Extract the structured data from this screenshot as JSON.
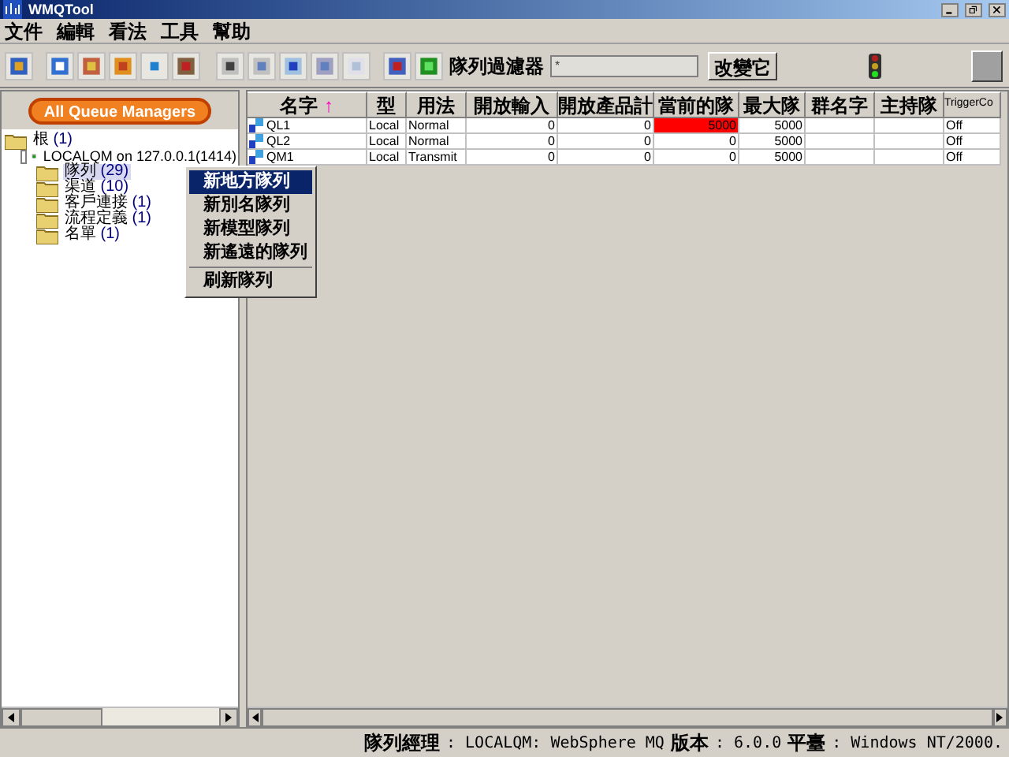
{
  "window": {
    "title": "WMQTool"
  },
  "menu": [
    "文件",
    "編輯",
    "看法",
    "工具",
    "幫助"
  ],
  "filter": {
    "label": "隊列過濾器",
    "value": "*",
    "button": "改變它"
  },
  "all_managers_button": "All Queue Managers",
  "tree": [
    {
      "label": "根",
      "count": "(1)",
      "kind": "root",
      "selected": false,
      "children": [
        {
          "label": "LOCALQM on 127.0.0.1(1414)",
          "kind": "manager",
          "selected": false,
          "children": [
            {
              "label": "隊列",
              "count": "(29)",
              "kind": "folder",
              "selected": true
            },
            {
              "label": "渠道",
              "count": "(10)",
              "kind": "folder",
              "selected": false
            },
            {
              "label": "客戶連接",
              "count": "(1)",
              "kind": "folder",
              "selected": false
            },
            {
              "label": "流程定義",
              "count": "(1)",
              "kind": "folder",
              "selected": false
            },
            {
              "label": "名單",
              "count": "(1)",
              "kind": "folder",
              "selected": false
            }
          ]
        }
      ]
    }
  ],
  "context_menu": {
    "sections": [
      {
        "items": [
          {
            "label": "新地方隊列",
            "selected": true
          },
          {
            "label": "新別名隊列",
            "selected": false
          },
          {
            "label": "新模型隊列",
            "selected": false
          },
          {
            "label": "新遙遠的隊列",
            "selected": false
          }
        ]
      },
      {
        "items": [
          {
            "label": "刷新隊列",
            "selected": false
          }
        ]
      }
    ]
  },
  "table": {
    "columns": [
      {
        "label": "名字",
        "sort": "↑"
      },
      {
        "label": "型"
      },
      {
        "label": "用法"
      },
      {
        "label": "開放輸入"
      },
      {
        "label": "開放產品計"
      },
      {
        "label": "當前的隊"
      },
      {
        "label": "最大隊"
      },
      {
        "label": "群名字"
      },
      {
        "label": "主持隊"
      },
      {
        "label": "TriggerCo"
      }
    ],
    "rows": [
      {
        "cells": [
          "QL1",
          "Local",
          "Normal",
          "0",
          "0",
          "5000",
          "5000",
          "",
          "",
          "Off"
        ],
        "full": true
      },
      {
        "cells": [
          "QL2",
          "Local",
          "Normal",
          "0",
          "0",
          "0",
          "5000",
          "",
          "",
          "Off"
        ],
        "full": false
      },
      {
        "cells": [
          "QM1",
          "Local",
          "Transmit",
          "0",
          "0",
          "0",
          "5000",
          "",
          "",
          "Off"
        ],
        "full": false
      }
    ]
  },
  "status_bar": [
    {
      "label": "隊列經理",
      "value": ": LOCALQM: WebSphere MQ"
    },
    {
      "label": "版本",
      "value": ": 6.0.0"
    },
    {
      "label": "平臺",
      "value": ": Windows NT/2000."
    }
  ]
}
